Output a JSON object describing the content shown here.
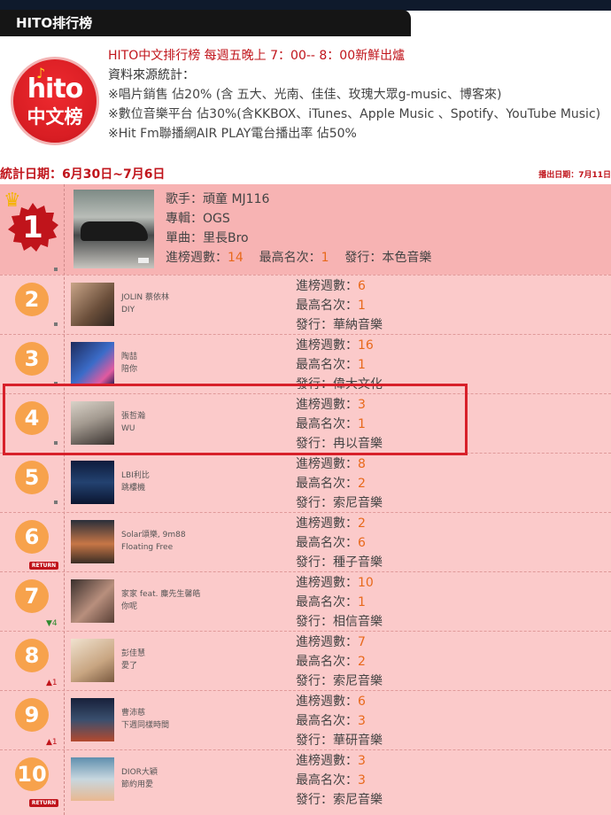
{
  "tab": {
    "label": "HITO排行榜"
  },
  "logo": {
    "line1": "hito",
    "line2": "中文榜",
    "note": "♪"
  },
  "info": {
    "headline": "HITO中文排行榜 每週五晚上 7：00-- 8：00新鮮出爐",
    "source_title": "資料來源統計：",
    "source_lines": [
      "※唱片銷售 佔20% (含 五大、光南、佳佳、玫瑰大眾g-music、博客來)",
      "※數位音樂平台 佔30%(含KKBOX、iTunes、Apple Music 、Spotify、YouTube Music)",
      "※Hit Fm聯播網AIR PLAY電台播出率 佔50%"
    ]
  },
  "stat_date": "統計日期：6月30日~7月6日",
  "air_date": "播出日期：7月11日",
  "labels": {
    "singer": "歌手：",
    "album": "專輯：",
    "single": "單曲：",
    "weeks": "進榜週數：",
    "peak": "最高名次：",
    "label": "發行："
  },
  "top": {
    "rank": "1",
    "singer": "頑童 MJ116",
    "album": "OGS",
    "single": "里長Bro",
    "weeks": "14",
    "peak": "1",
    "label": "本色音樂"
  },
  "entries": [
    {
      "rank": "2",
      "artist": "JOLIN 蔡依林",
      "song": "DIY",
      "weeks": "6",
      "peak": "1",
      "label": "華納音樂",
      "move": ""
    },
    {
      "rank": "3",
      "artist": "陶喆",
      "song": "陪你",
      "weeks": "16",
      "peak": "1",
      "label": "偉大文化",
      "move": ""
    },
    {
      "rank": "4",
      "artist": "張哲瀚",
      "song": "WU",
      "weeks": "3",
      "peak": "1",
      "label": "冉以音樂",
      "move": ""
    },
    {
      "rank": "5",
      "artist": "LBI利比",
      "song": "跳樓機",
      "weeks": "8",
      "peak": "2",
      "label": "索尼音樂",
      "move": ""
    },
    {
      "rank": "6",
      "artist": "Solar頌樂, 9m88",
      "song": "Floating Free",
      "weeks": "2",
      "peak": "6",
      "label": "種子音樂",
      "move": "RETURN"
    },
    {
      "rank": "7",
      "artist": "家家 feat. 麋先生馨皓",
      "song": "你呢",
      "weeks": "10",
      "peak": "1",
      "label": "相信音樂",
      "move": "▼4"
    },
    {
      "rank": "8",
      "artist": "彭佳慧",
      "song": "愛了",
      "weeks": "7",
      "peak": "2",
      "label": "索尼音樂",
      "move": "▲1"
    },
    {
      "rank": "9",
      "artist": "曹沛慈",
      "song": "下週同樣時間",
      "weeks": "6",
      "peak": "3",
      "label": "華研音樂",
      "move": "▲1"
    },
    {
      "rank": "10",
      "artist": "DIOR大穎",
      "song": "節約用愛",
      "weeks": "3",
      "peak": "3",
      "label": "索尼音樂",
      "move": "RETURN"
    }
  ],
  "colors": {
    "accent_red": "#c0141b",
    "rank_orange": "#f7a24c",
    "value_orange": "#e8691b",
    "row_pink": "#fbcaca",
    "top_pink": "#f7b3b3"
  }
}
